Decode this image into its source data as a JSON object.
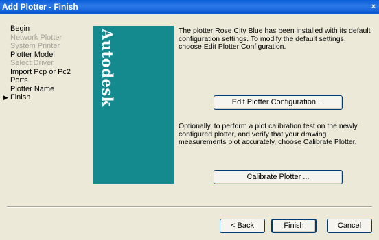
{
  "window": {
    "title": "Add Plotter - Finish",
    "close_glyph": "×"
  },
  "steps": [
    {
      "label": "Begin",
      "enabled": true,
      "current": false
    },
    {
      "label": "Network Plotter",
      "enabled": false,
      "current": false
    },
    {
      "label": "System Printer",
      "enabled": false,
      "current": false
    },
    {
      "label": "Plotter Model",
      "enabled": true,
      "current": false
    },
    {
      "label": "Select Driver",
      "enabled": false,
      "current": false
    },
    {
      "label": "Import Pcp or Pc2",
      "enabled": true,
      "current": false
    },
    {
      "label": "Ports",
      "enabled": true,
      "current": false
    },
    {
      "label": "Plotter Name",
      "enabled": true,
      "current": false
    },
    {
      "label": "Finish",
      "enabled": true,
      "current": true
    }
  ],
  "banner": {
    "text": "Autodesk",
    "color": "#148a8f"
  },
  "content": {
    "message1": "The plotter Rose City Blue has been installed with its default configuration settings.  To modify the default settings, choose Edit Plotter Configuration.",
    "edit_button": "Edit Plotter Configuration ...",
    "message2": "Optionally, to perform a plot calibration test on the newly configured plotter, and verify that your drawing measurements plot accurately, choose Calibrate Plotter.",
    "calibrate_button": "Calibrate Plotter ..."
  },
  "footer": {
    "back_button": "< Back",
    "finish_button": "Finish",
    "cancel_button": "Cancel"
  }
}
